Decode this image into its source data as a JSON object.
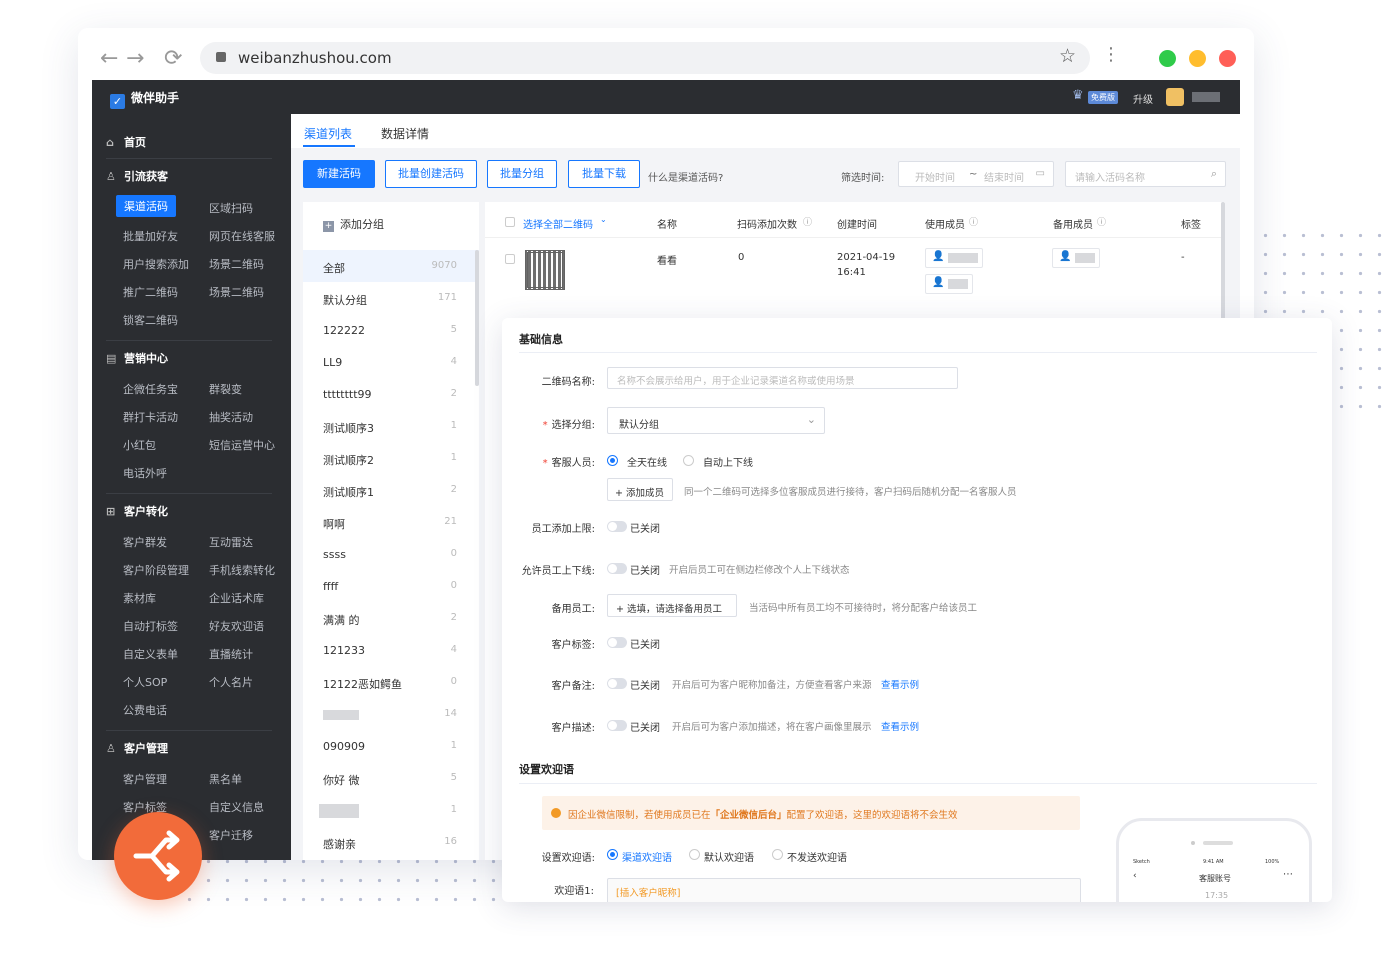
{
  "browser": {
    "url": "weibanzhushou.com"
  },
  "app": {
    "brand": "微伴助手",
    "badge": "免费版",
    "upgrade": "升级"
  },
  "sidebar": {
    "home": "首页",
    "sections": [
      {
        "title": "引流获客",
        "items": [
          "渠道活码",
          "区域扫码",
          "批量加好友",
          "网页在线客服",
          "用户搜索添加",
          "场景二维码",
          "推广二维码",
          "场景二维码",
          "锁客二维码"
        ]
      },
      {
        "title": "营销中心",
        "items": [
          "企微任务宝",
          "群裂变",
          "群打卡活动",
          "抽奖活动",
          "小红包",
          "短信运营中心",
          "电话外呼"
        ]
      },
      {
        "title": "客户转化",
        "items": [
          "客户群发",
          "互动雷达",
          "客户阶段管理",
          "手机线索转化",
          "素材库",
          "企业话术库",
          "自动打标签",
          "好友欢迎语",
          "自定义表单",
          "直播统计",
          "个人SOP",
          "个人名片",
          "公费电话"
        ]
      },
      {
        "title": "客户管理",
        "items": [
          "客户管理",
          "黑名单",
          "客户标签",
          "自定义信息",
          "客户迁移"
        ]
      }
    ]
  },
  "tabs": [
    "渠道列表",
    "数据详情"
  ],
  "toolbar": {
    "new": "新建活码",
    "batch_create": "批量创建活码",
    "batch_group": "批量分组",
    "batch_download": "批量下载",
    "what": "什么是渠道活码?",
    "filter_label": "筛选时间:",
    "start_placeholder": "开始时间",
    "tilde": "~",
    "end_placeholder": "结束时间",
    "search_placeholder": "请输入活码名称"
  },
  "groups": {
    "add": "添加分组",
    "items": [
      {
        "name": "全部",
        "count": "9070"
      },
      {
        "name": "默认分组",
        "count": "171"
      },
      {
        "name": "122222",
        "count": "5"
      },
      {
        "name": "LL9",
        "count": "4"
      },
      {
        "name": "tttttttt99",
        "count": "2"
      },
      {
        "name": "测试顺序3",
        "count": "1"
      },
      {
        "name": "测试顺序2",
        "count": "1"
      },
      {
        "name": "测试顺序1",
        "count": "2"
      },
      {
        "name": "啊啊",
        "count": "21"
      },
      {
        "name": "ssss",
        "count": "0"
      },
      {
        "name": "ffff",
        "count": "0"
      },
      {
        "name": "满满 的",
        "count": "2"
      },
      {
        "name": "121233",
        "count": "4"
      },
      {
        "name": "12122恶如鳄鱼",
        "count": "0"
      },
      {
        "name": "",
        "count": "14"
      },
      {
        "name": "090909",
        "count": "1"
      },
      {
        "name": "你好 微",
        "count": "5"
      },
      {
        "name": "",
        "count": "1"
      },
      {
        "name": "感谢亲",
        "count": "16"
      }
    ]
  },
  "table": {
    "headers": [
      "选择全部二维码",
      "名称",
      "扫码添加次数",
      "创建时间",
      "使用成员",
      "备用成员",
      "标签"
    ],
    "row": {
      "name": "看看",
      "scans": "0",
      "date": "2021-04-19",
      "time": "16:41",
      "tag": "-"
    }
  },
  "form": {
    "section1": "基础信息",
    "qr_name_label": "二维码名称:",
    "qr_name_placeholder": "名称不会展示给用户，用于企业记录渠道名称或使用场景",
    "group_label": "选择分组:",
    "group_value": "默认分组",
    "staff_label": "客服人员:",
    "staff_opt1": "全天在线",
    "staff_opt2": "自动上下线",
    "add_member": "+ 添加成员",
    "add_member_hint": "同一个二维码可选择多位客服成员进行接待，客户扫码后随机分配一名客服人员",
    "limit_label": "员工添加上限:",
    "closed": "已关闭",
    "online_label": "允许员工上下线:",
    "online_hint": "开启后员工可在侧边栏修改个人上下线状态",
    "backup_label": "备用员工:",
    "backup_btn": "+ 选填，请选择备用员工",
    "backup_hint": "当活码中所有员工均不可接待时，将分配客户给该员工",
    "tag_label": "客户标签:",
    "remark_label": "客户备注:",
    "remark_hint": "开启后可为客户昵称加备注，方便查看客户来源",
    "example": "查看示例",
    "desc_label": "客户描述:",
    "desc_hint": "开启后可为客户添加描述，将在客户画像里展示",
    "section2": "设置欢迎语",
    "warn_pre": "因企业微信限制，若使用成员已在",
    "warn_bold": "「企业微信后台」",
    "warn_post": "配置了欢迎语，这里的欢迎语将不会生效",
    "welcome_label": "设置欢迎语:",
    "welcome_opt1": "渠道欢迎语",
    "welcome_opt2": "默认欢迎语",
    "welcome_opt3": "不发送欢迎语",
    "welcome1_label": "欢迎语1:",
    "insert_nick": "[插入客户昵称]"
  },
  "phone": {
    "carrier": "Sketch",
    "clock": "9:41 AM",
    "battery": "100%",
    "title": "客服账号",
    "time": "17:35"
  },
  "colors": {
    "accent": "#1677ff",
    "sidebar": "#2b2d31",
    "fab": "#f26b3a",
    "warning": "#f29a26"
  }
}
